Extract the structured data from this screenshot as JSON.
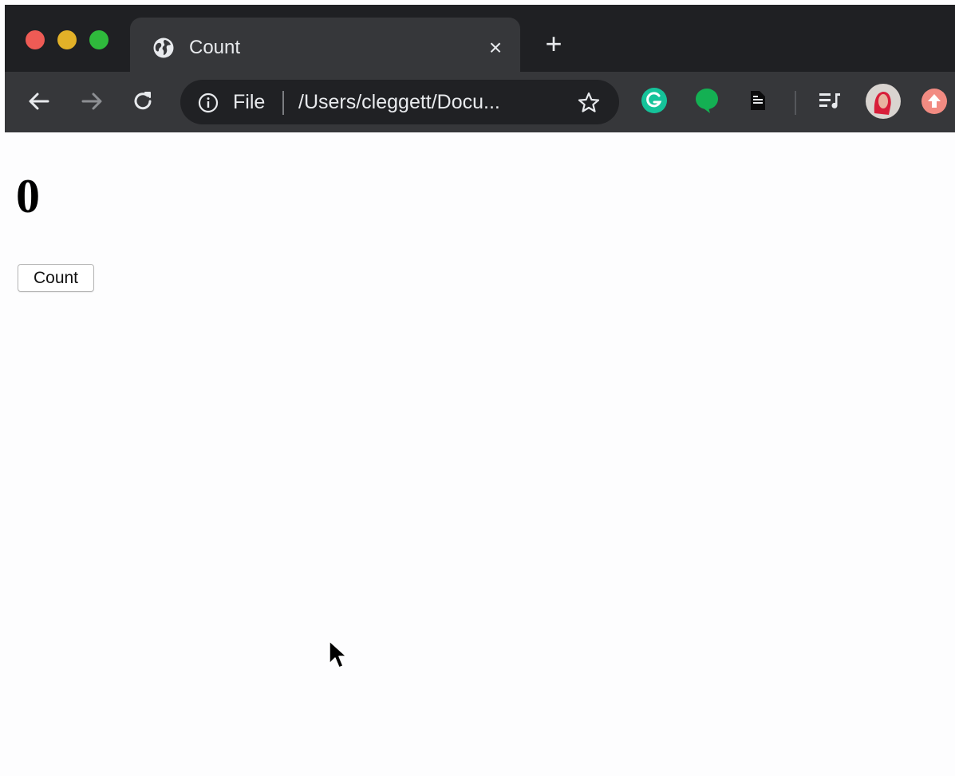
{
  "browser": {
    "tab": {
      "title": "Count",
      "close_label": "×"
    },
    "new_tab_label": "+",
    "address": {
      "scheme": "File",
      "url": "/Users/cleggett/Docu..."
    },
    "colors": {
      "frame": "#1f2023",
      "toolbar": "#36373a",
      "omnibox": "#202124",
      "text": "#e8eaed"
    },
    "icons": [
      "globe-icon",
      "back-arrow-icon",
      "forward-arrow-icon",
      "reload-icon",
      "info-icon",
      "star-icon",
      "grammarly-extension-icon",
      "chat-extension-icon",
      "document-extension-icon",
      "media-control-icon",
      "profile-avatar-icon",
      "update-icon"
    ]
  },
  "page": {
    "count_value": "0",
    "count_button_label": "Count"
  }
}
